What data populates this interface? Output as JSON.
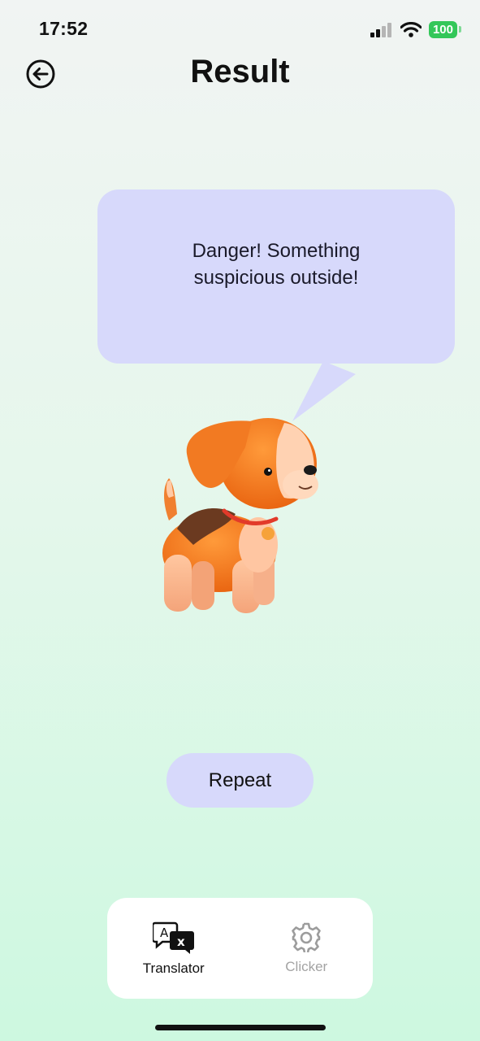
{
  "status_bar": {
    "time": "17:52",
    "battery": "100",
    "icons": [
      "signal-icon",
      "wifi-icon",
      "battery-icon"
    ],
    "battery_color": "#33c759"
  },
  "header": {
    "title": "Result",
    "back_icon": "arrow-left-circle-icon"
  },
  "speech_bubble": {
    "text": "Danger! Something suspicious outside!",
    "color": "#d7d9fb"
  },
  "illustration": {
    "subject": "dog-illustration"
  },
  "actions": {
    "repeat_label": "Repeat",
    "button_color": "#d7d9fb"
  },
  "tab_bar": {
    "tabs": [
      {
        "label": "Translator",
        "icon": "translate-icon",
        "active": true
      },
      {
        "label": "Clicker",
        "icon": "gear-icon",
        "active": false
      }
    ]
  }
}
